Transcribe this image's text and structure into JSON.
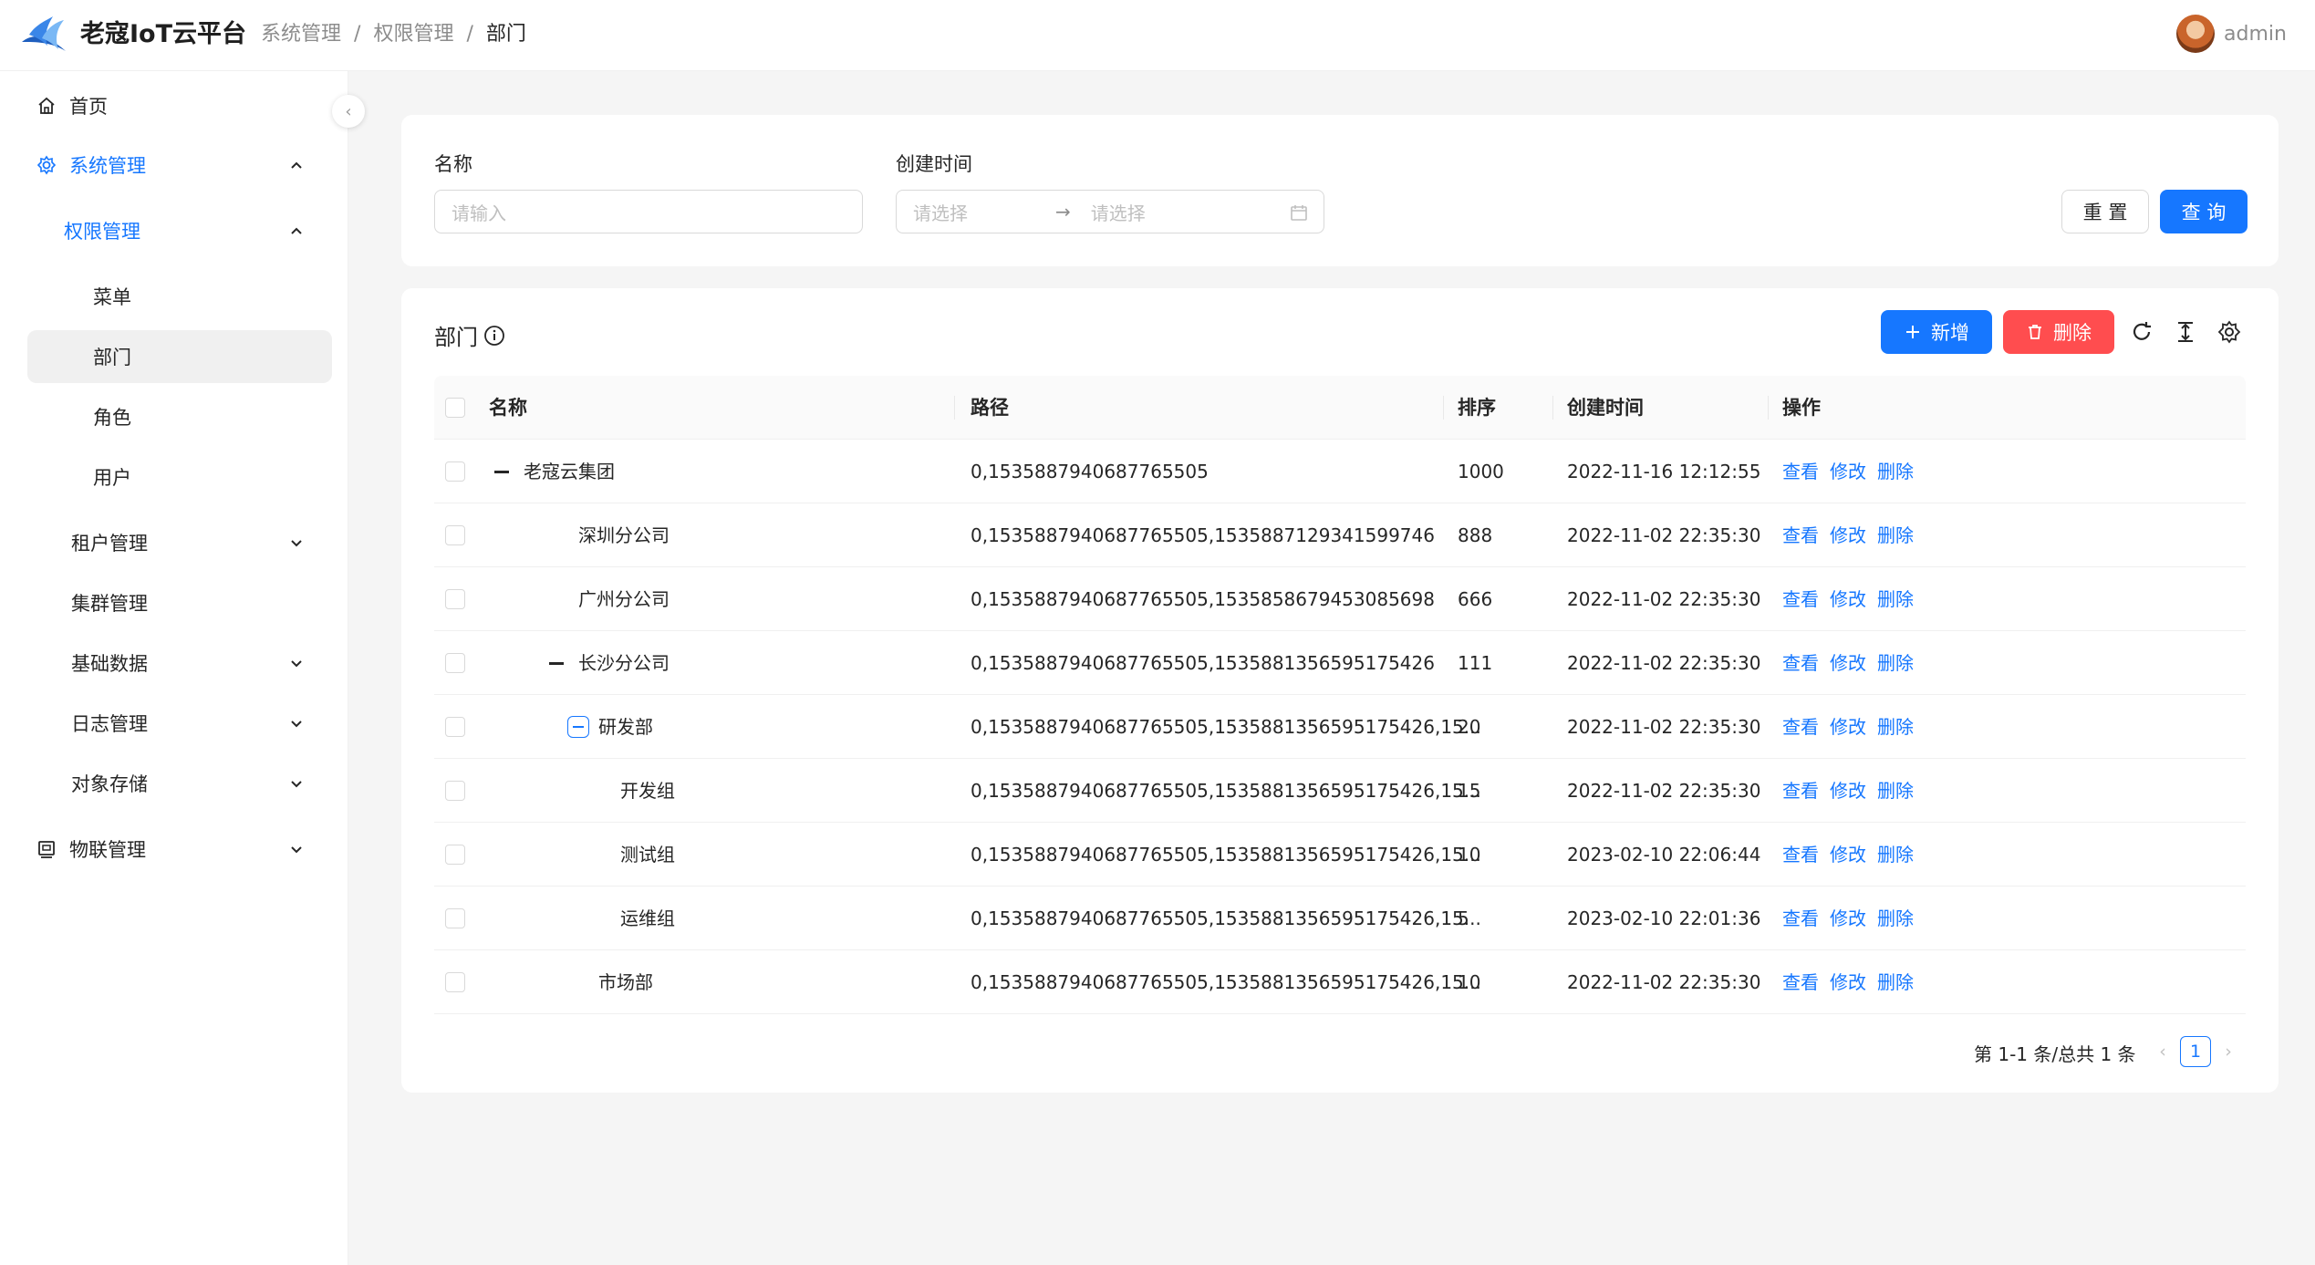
{
  "header": {
    "app_title": "老寇IoT云平台",
    "breadcrumb": [
      "系统管理",
      "权限管理",
      "部门"
    ],
    "breadcrumb_sep": "/",
    "user_name": "admin"
  },
  "sidebar": {
    "collapse_glyph": "‹",
    "items": {
      "home": "首页",
      "system": "系统管理",
      "permission": "权限管理",
      "menu": "菜单",
      "dept": "部门",
      "role": "角色",
      "user": "用户",
      "tenant": "租户管理",
      "cluster": "集群管理",
      "basic": "基础数据",
      "log": "日志管理",
      "oss": "对象存储",
      "iot": "物联管理"
    }
  },
  "search": {
    "name_label": "名称",
    "name_placeholder": "请输入",
    "time_label": "创建时间",
    "start_placeholder": "请选择",
    "range_arrow": "→",
    "end_placeholder": "请选择",
    "reset": "重 置",
    "query": "查 询"
  },
  "table": {
    "title": "部门",
    "add": "新增",
    "delete": "删除",
    "columns": {
      "name": "名称",
      "path": "路径",
      "sort": "排序",
      "created": "创建时间",
      "actions": "操作"
    },
    "action_labels": {
      "view": "查看",
      "edit": "修改",
      "delete": "删除"
    },
    "rows": [
      {
        "name": "老寇云集团",
        "path": "0,1535887940687765505",
        "sort": "1000",
        "created": "2022-11-16 12:12:55"
      },
      {
        "name": "深圳分公司",
        "path": "0,1535887940687765505,1535887129341599746",
        "sort": "888",
        "created": "2022-11-02 22:35:30"
      },
      {
        "name": "广州分公司",
        "path": "0,1535887940687765505,1535858679453085698",
        "sort": "666",
        "created": "2022-11-02 22:35:30"
      },
      {
        "name": "长沙分公司",
        "path": "0,1535887940687765505,1535881356595175426",
        "sort": "111",
        "created": "2022-11-02 22:35:30"
      },
      {
        "name": "研发部",
        "path": "0,1535887940687765505,1535881356595175426,15...",
        "sort": "20",
        "created": "2022-11-02 22:35:30"
      },
      {
        "name": "开发组",
        "path": "0,1535887940687765505,1535881356595175426,15...",
        "sort": "15",
        "created": "2022-11-02 22:35:30"
      },
      {
        "name": "测试组",
        "path": "0,1535887940687765505,1535881356595175426,15...",
        "sort": "10",
        "created": "2023-02-10 22:06:44"
      },
      {
        "name": "运维组",
        "path": "0,1535887940687765505,1535881356595175426,15...",
        "sort": "5",
        "created": "2023-02-10 22:01:36"
      },
      {
        "name": "市场部",
        "path": "0,1535887940687765505,1535881356595175426,15...",
        "sort": "10",
        "created": "2022-11-02 22:35:30"
      }
    ]
  },
  "pagination": {
    "summary": "第 1-1 条/总共 1 条",
    "current_page": "1",
    "prev_glyph": "‹",
    "next_glyph": "›"
  },
  "colors": {
    "primary": "#1677ff",
    "danger": "#ff4d4f"
  }
}
